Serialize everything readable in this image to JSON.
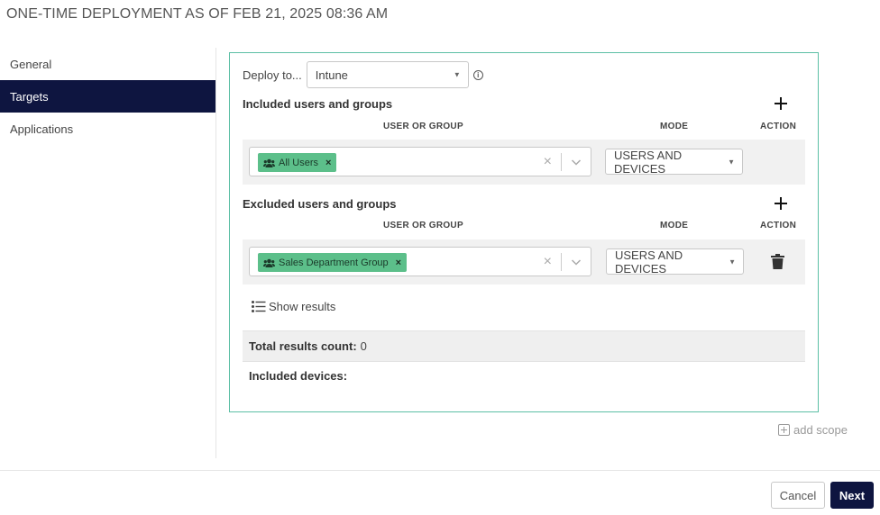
{
  "page": {
    "title": "ONE-TIME DEPLOYMENT AS OF FEB 21, 2025 08:36 AM"
  },
  "sidebar": {
    "items": [
      {
        "label": "General",
        "active": false
      },
      {
        "label": "Targets",
        "active": true
      },
      {
        "label": "Applications",
        "active": false
      }
    ]
  },
  "deploy": {
    "label": "Deploy to...",
    "value": "Intune"
  },
  "included": {
    "title": "Included users and groups",
    "col_user": "USER OR GROUP",
    "col_mode": "MODE",
    "col_action": "ACTION",
    "chip": "All Users",
    "mode": "USERS AND DEVICES"
  },
  "excluded": {
    "title": "Excluded users and groups",
    "col_user": "USER OR GROUP",
    "col_mode": "MODE",
    "col_action": "ACTION",
    "chip": "Sales Department Group",
    "mode": "USERS AND DEVICES"
  },
  "results": {
    "show_label": "Show results",
    "count_label": "Total results count:",
    "count_value": "0",
    "devices_label": "Included devices:"
  },
  "add_scope": "add scope",
  "footer": {
    "cancel": "Cancel",
    "next": "Next"
  },
  "colors": {
    "nav_active": "#0e1540",
    "chip": "#5cbf8a",
    "panel_border": "#5cbfa5"
  },
  "icons": [
    "info-icon",
    "plus-icon",
    "users-icon",
    "close-icon",
    "chevron-down-icon",
    "trash-icon",
    "list-icon",
    "add-box-icon"
  ]
}
